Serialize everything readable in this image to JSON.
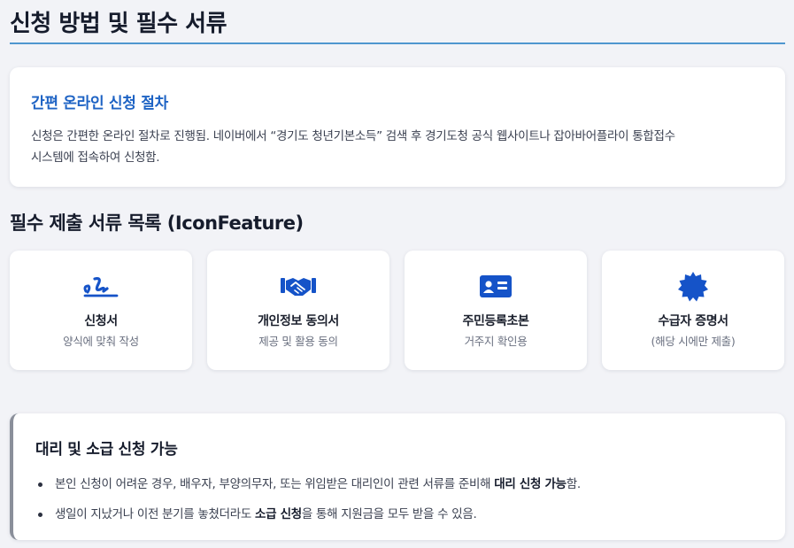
{
  "page_title": "신청 방법 및 필수 서류",
  "intro": {
    "heading": "간편 온라인 신청 절차",
    "line1": "신청은 간편한 온라인 절차로 진행됨. 네이버에서 “경기도 청년기본소득” 검색 후 경기도청 공식 웹사이트나 잡아바어플라이 통합접수",
    "line2": "시스템에 접속하여 신청함."
  },
  "docs_title": "필수 제출 서류 목록 (IconFeature)",
  "docs": [
    {
      "name": "신청서",
      "desc": "양식에 맞춰 작성",
      "icon": "signature-icon"
    },
    {
      "name": "개인정보 동의서",
      "desc": "제공 및 활용 동의",
      "icon": "handshake-icon"
    },
    {
      "name": "주민등록초본",
      "desc": "거주지 확인용",
      "icon": "id-card-icon"
    },
    {
      "name": "수급자 증명서",
      "desc": "(해당 시에만 제출)",
      "icon": "certificate-badge-icon"
    }
  ],
  "proxy": {
    "heading": "대리 및 소급 신청 가능",
    "item1": {
      "pre": "본인 신청이 어려운 경우, 배우자, 부양의무자, 또는 위임받은 대리인이 관련 서류를 준비해 ",
      "bold": "대리 신청 가능",
      "post": "함."
    },
    "item2": {
      "pre": "생일이 지났거나 이전 분기를 놓쳤더라도 ",
      "bold": "소급 신청",
      "post": "을 통해 지원금을 모두 받을 수 있음."
    }
  },
  "colors": {
    "accent": "#1e63c4",
    "icon": "#1553c8",
    "title_rule": "#4f97cf",
    "background": "#f2f3f7"
  }
}
